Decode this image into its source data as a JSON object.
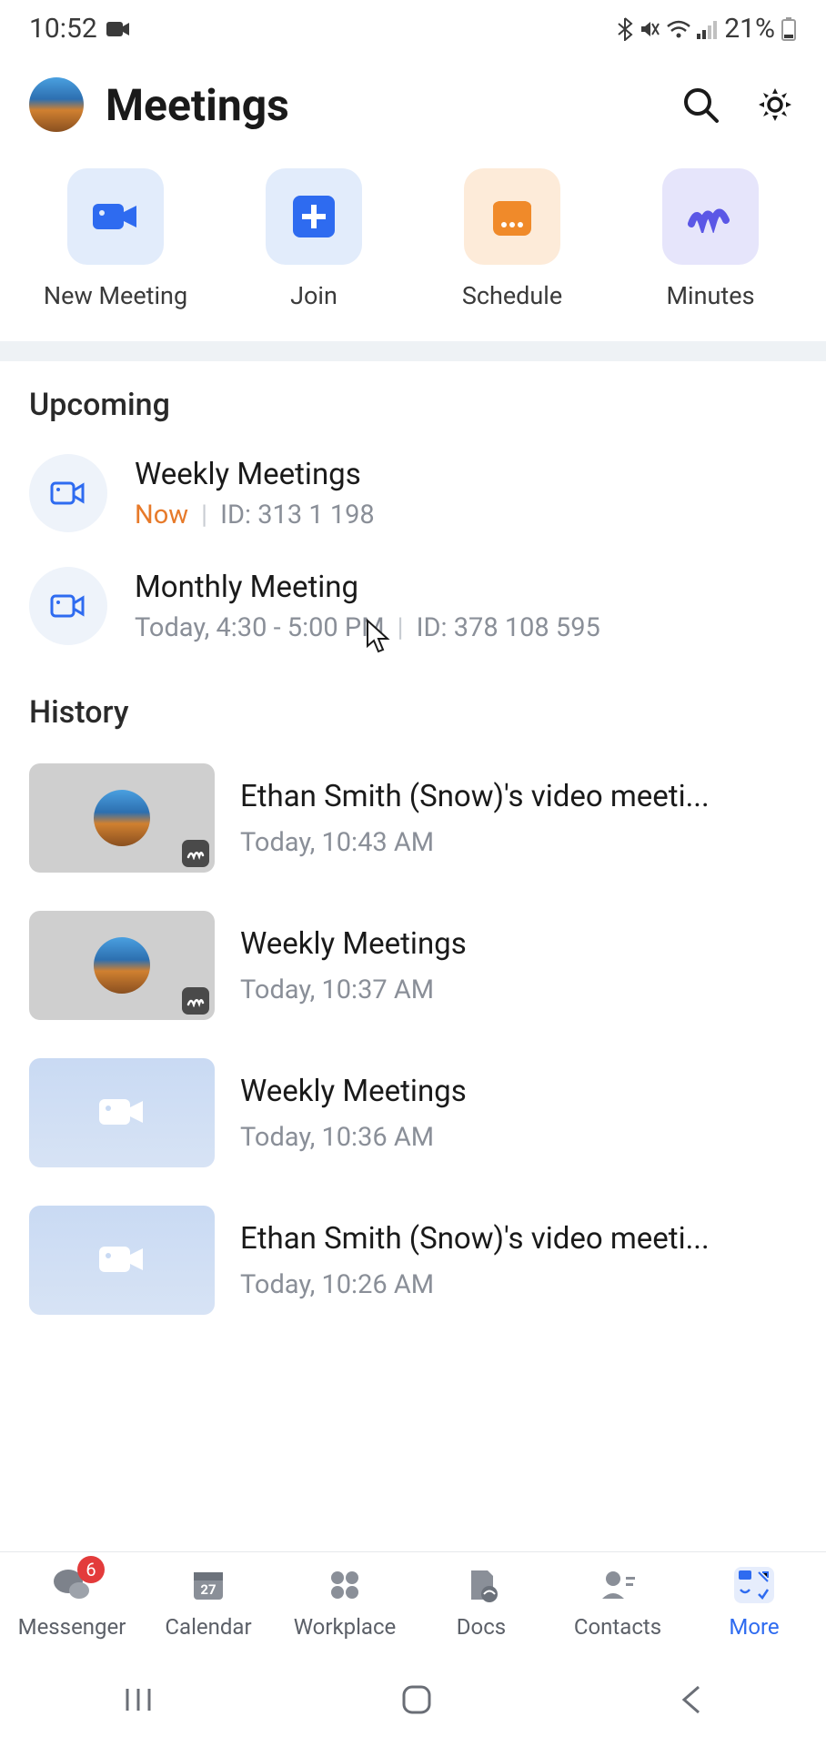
{
  "status": {
    "time": "10:52",
    "battery_text": "21%"
  },
  "header": {
    "title": "Meetings"
  },
  "actions": {
    "new_meeting": "New Meeting",
    "join": "Join",
    "schedule": "Schedule",
    "minutes": "Minutes"
  },
  "upcoming": {
    "section_title": "Upcoming",
    "items": [
      {
        "title": "Weekly Meetings",
        "status": "Now",
        "id_label": "ID: 313 1    198"
      },
      {
        "title": "Monthly Meeting",
        "time": "Today, 4:30 - 5:00 PM",
        "id_label": "ID: 378 108 595"
      }
    ]
  },
  "history": {
    "section_title": "History",
    "items": [
      {
        "title": "Ethan Smith (Snow)'s video meeti...",
        "time": "Today, 10:43 AM",
        "thumb": "grey",
        "badge": true
      },
      {
        "title": "Weekly Meetings",
        "time": "Today, 10:37 AM",
        "thumb": "grey",
        "badge": true
      },
      {
        "title": "Weekly Meetings",
        "time": "Today, 10:36 AM",
        "thumb": "blue",
        "badge": false
      },
      {
        "title": "Ethan Smith (Snow)'s video meeti...",
        "time": "Today, 10:26 AM",
        "thumb": "blue",
        "badge": false
      }
    ]
  },
  "bottom_nav": {
    "messenger": {
      "label": "Messenger",
      "badge": "6"
    },
    "calendar": {
      "label": "Calendar",
      "day": "27"
    },
    "workplace": {
      "label": "Workplace"
    },
    "docs": {
      "label": "Docs"
    },
    "contacts": {
      "label": "Contacts"
    },
    "more": {
      "label": "More"
    }
  }
}
